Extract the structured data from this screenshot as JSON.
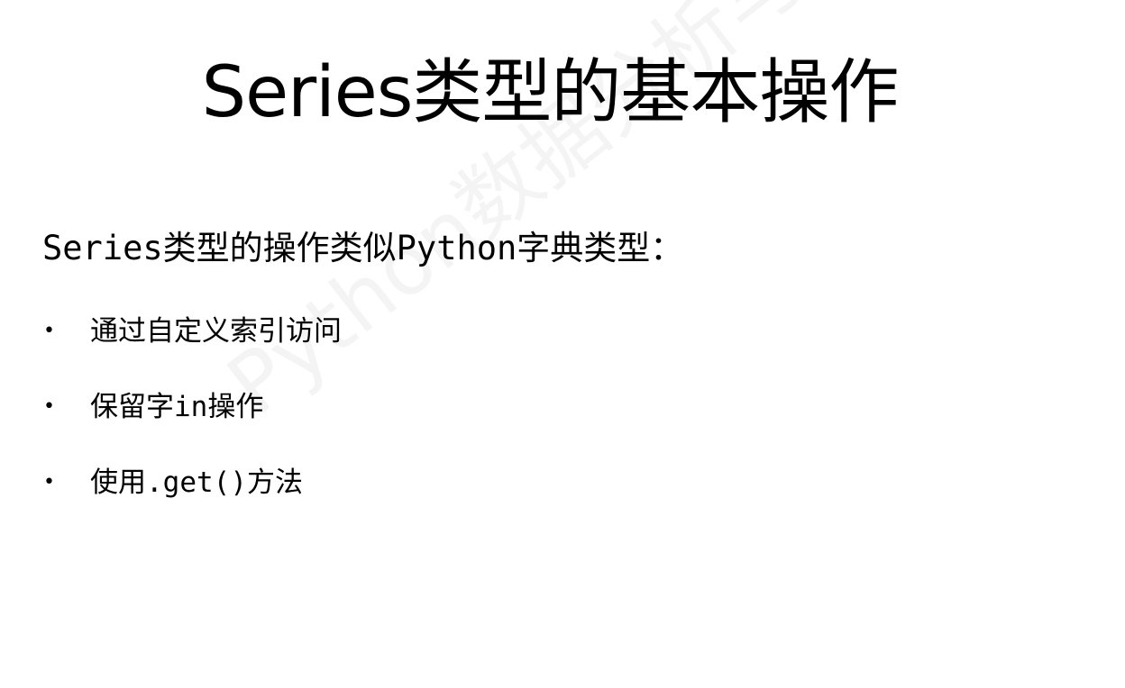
{
  "slide": {
    "title": "Series类型的基本操作",
    "subtitle": "Series类型的操作类似Python字典类型：",
    "bullet_symbol": "•",
    "bullets": [
      {
        "text": "通过自定义索引访问"
      },
      {
        "text": "保留字in操作"
      },
      {
        "text": "使用.get()方法"
      }
    ],
    "watermark": "Python数据分析与展示"
  }
}
